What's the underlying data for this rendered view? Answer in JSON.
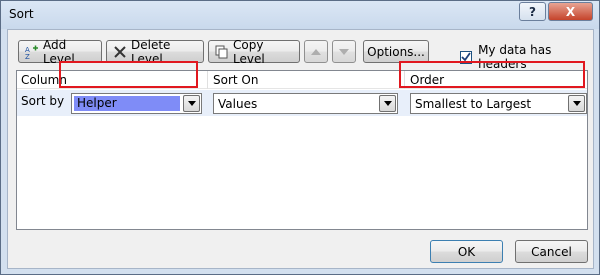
{
  "window": {
    "title": "Sort",
    "help_label": "?",
    "close_label": "X"
  },
  "toolbar": {
    "add_level": "Add Level",
    "delete_level": "Delete Level",
    "copy_level": "Copy Level",
    "options": "Options...",
    "my_data_has_headers": "My data has headers",
    "my_data_has_headers_checked": true
  },
  "grid": {
    "columns": [
      "Column",
      "Sort On",
      "Order"
    ],
    "rows": [
      {
        "label": "Sort by",
        "column": "Helper",
        "sort_on": "Values",
        "order": "Smallest to Largest"
      }
    ]
  },
  "footer": {
    "ok": "OK",
    "cancel": "Cancel"
  },
  "colors": {
    "highlight": "#e1181f",
    "selection": "#7f8cf7",
    "row_bg": "#e8effa"
  }
}
